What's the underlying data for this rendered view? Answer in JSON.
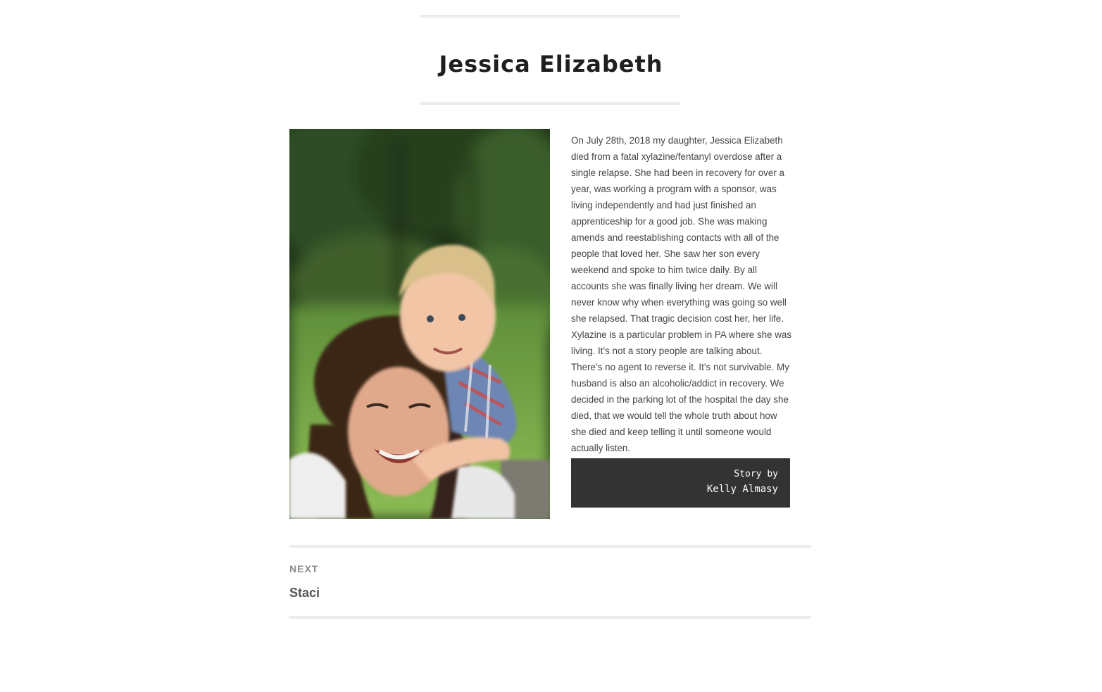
{
  "post": {
    "title": "Jessica Elizabeth",
    "photo_alt": "Photo of Jessica Elizabeth smiling with her young son on her back outdoors",
    "story": "On July 28th, 2018 my daughter, Jessica Elizabeth died from a fatal xylazine/fentanyl overdose after a single relapse. She had been in recovery for over a year, was working a program with a sponsor, was living independently and had just finished an apprenticeship for a good job. She was making amends and reestablishing contacts with all of the people that loved her. She saw her son every weekend and spoke to him twice daily. By all accounts she was finally living her dream. We will never know why when everything was going so well she relapsed. That tragic decision cost her, her life. Xylazine is a particular problem in PA where she was living. It’s not a story people are talking about. There’s no agent to reverse it. It’s not survivable. My husband is also an alcoholic/addict in recovery. We decided in the parking lot of the hospital the day she died, that we would tell the whole truth about how she died and keep telling it until someone would actually listen.",
    "byline": {
      "label": "Story by",
      "author": "Kelly Almasy"
    }
  },
  "navigation": {
    "next_label": "NEXT",
    "next_title": "Staci"
  }
}
